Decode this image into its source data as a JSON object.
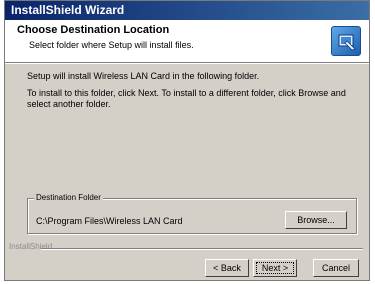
{
  "window": {
    "title": "InstallShield Wizard"
  },
  "header": {
    "title": "Choose Destination Location",
    "subtitle": "Select folder where Setup will install files.",
    "icon": "setup-icon"
  },
  "body": {
    "intro": "Setup will install Wireless LAN Card in the following folder.",
    "instructions": "To install to this folder, click Next. To install to a different folder, click Browse and select another folder."
  },
  "destination": {
    "legend": "Destination Folder",
    "path": "C:\\Program Files\\Wireless LAN Card",
    "browse_label": "Browse..."
  },
  "footer": {
    "brand": "InstallShield",
    "back_label": "< Back",
    "next_label": "Next >",
    "cancel_label": "Cancel"
  },
  "colors": {
    "titlebar_start": "#0a246a",
    "titlebar_end": "#3a6ea5",
    "dialog_bg": "#d4d0c8"
  }
}
